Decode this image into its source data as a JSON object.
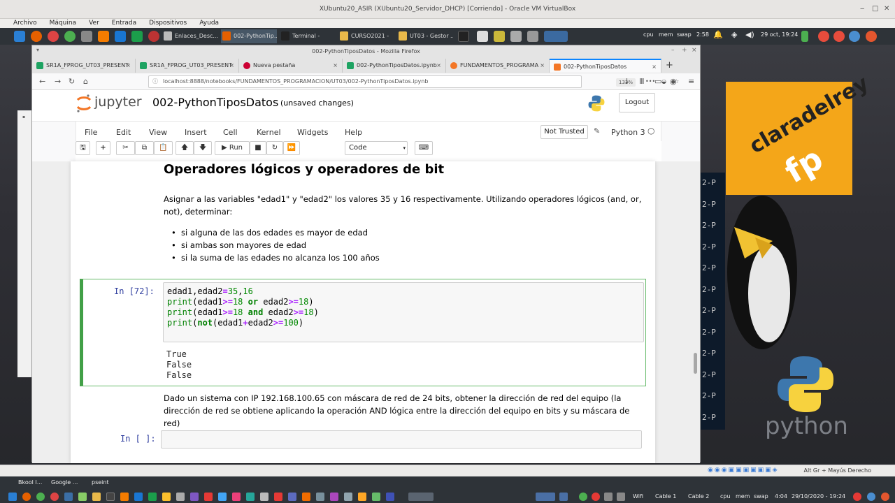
{
  "vbox": {
    "title": "XUbuntu20_ASIR (XUbuntu20_Servidor_DHCP) [Corriendo] - Oracle VM VirtualBox",
    "menu": [
      "Archivo",
      "Máquina",
      "Ver",
      "Entrada",
      "Dispositivos",
      "Ayuda"
    ],
    "status_text": "Alt Gr + Mayús Derecho"
  },
  "panel": {
    "tasks": [
      "Enlaces_Desc...",
      "002-PythonTip...",
      "Terminal -",
      "CURSO2021 -",
      "UT03 - Gestor ..."
    ],
    "cpu": "cpu",
    "mem": "mem",
    "swap": "swap",
    "time": "2:58",
    "date": "29 oct, 19:24"
  },
  "firefox": {
    "title": "002-PythonTiposDatos - Mozilla Firefox",
    "tabs": [
      {
        "label": "SR1A_FPROG_UT03_PRESENT"
      },
      {
        "label": "SR1A_FPROG_UT03_PRESENT"
      },
      {
        "label": "Nueva pestaña"
      },
      {
        "label": "002-PythonTiposDatos.ipynb"
      },
      {
        "label": "FUNDAMENTOS_PROGRAMA"
      },
      {
        "label": "002-PythonTiposDatos"
      }
    ],
    "url": "localhost:8888/notebooks/FUNDAMENTOS_PROGRAMACION/UT03/002-PythonTiposDatos.ipynb",
    "zoom": "133%"
  },
  "jupyter": {
    "logo_text": "jupyter",
    "notebook_name": "002-PythonTiposDatos",
    "unsaved": "(unsaved changes)",
    "logout": "Logout",
    "menu": [
      "File",
      "Edit",
      "View",
      "Insert",
      "Cell",
      "Kernel",
      "Widgets",
      "Help"
    ],
    "not_trusted": "Not Trusted",
    "kernel": "Python 3",
    "run_label": "Run",
    "cell_type": "Code"
  },
  "notebook": {
    "heading": "Operadores lógicos y operadores de bit",
    "paragraph": "Asignar a las variables \"edad1\" y \"edad2\" los valores 35 y 16 respectivamente. Utilizando operadores lógicos (and, or, not), determinar:",
    "bullets": [
      "si alguna de las dos edades es mayor de edad",
      "si ambas son mayores de edad",
      "si la suma de las edades no alcanza los 100 años"
    ],
    "cell1": {
      "prompt": "In [72]:",
      "code": [
        "edad1,edad2=35,16",
        "print(edad1>=18 or edad2>=18)",
        "print(edad1>=18 and edad2>=18)",
        "print(not(edad1+edad2>=100)"
      ],
      "output": [
        "True",
        "False",
        "False"
      ]
    },
    "paragraph2": "Dado un sistema con IP 192.168.100.65 con máscara de red de 24 bits, obtener la dirección de red del equipo (la dirección de red se obtiene aplicando la operación AND lógica entre la dirección del equipo en bits y su máscara de red)",
    "cell2": {
      "prompt": "In [ ]:"
    }
  },
  "desktop": {
    "terminal_lines": [
      "2-P",
      "2-P",
      "2-P",
      "2-P",
      "2-P",
      "2-P",
      "2-P",
      "2-P",
      "2-P",
      "2-P",
      "2-P",
      "2-P"
    ],
    "badge_line1": "claradelrey",
    "badge_line2": "fp",
    "python_text": "python"
  },
  "bottom": {
    "tasks": [
      "Bkool I...",
      "Google ...",
      "pseint"
    ],
    "wifi": "Wifi",
    "cable1": "Cable 1",
    "cable2": "Cable 2",
    "cpu": "cpu",
    "mem": "mem",
    "swap": "swap",
    "time": "4:04",
    "datetime": "29/10/2020 - 19:24"
  },
  "colors": {
    "jupyter_orange": "#f37626",
    "cell_green": "#42a047",
    "firefox_blue": "#0a84ff",
    "panel_dark": "#2e3338"
  }
}
